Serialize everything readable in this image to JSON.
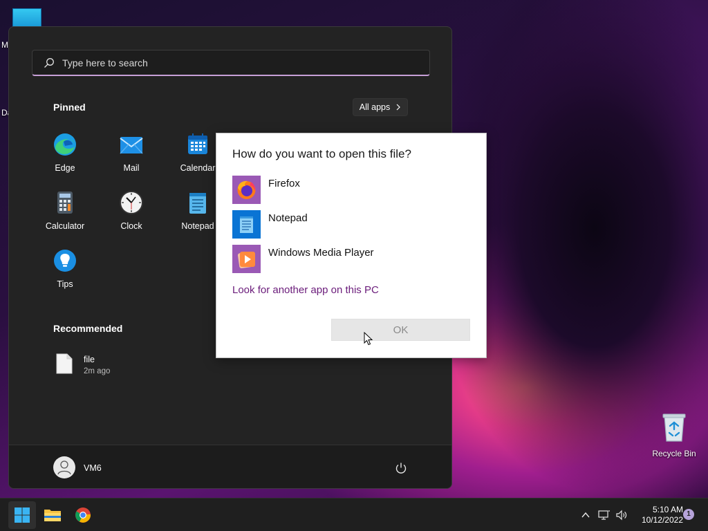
{
  "desktop": {
    "edge_letters": [
      "M",
      "Da"
    ],
    "recycle_bin_label": "Recycle Bin"
  },
  "start_menu": {
    "search": {
      "placeholder": "Type here to search",
      "value": ""
    },
    "pinned_title": "Pinned",
    "all_apps_label": "All apps",
    "pinned_apps": [
      {
        "label": "Edge",
        "icon": "edge-icon"
      },
      {
        "label": "Mail",
        "icon": "mail-icon"
      },
      {
        "label": "Calendar",
        "icon": "calendar-icon"
      },
      {
        "label": "Calculator",
        "icon": "calculator-icon"
      },
      {
        "label": "Clock",
        "icon": "clock-icon"
      },
      {
        "label": "Notepad",
        "icon": "notepad-icon"
      },
      {
        "label": "Tips",
        "icon": "tips-icon"
      }
    ],
    "recommended_title": "Recommended",
    "recommended": [
      {
        "name": "file",
        "time": "2m ago",
        "icon": "document-icon"
      }
    ],
    "user_name": "VM6"
  },
  "dialog": {
    "title": "How do you want to open this file?",
    "apps": [
      {
        "name": "Firefox",
        "icon": "firefox-icon",
        "color": "#9a59b5"
      },
      {
        "name": "Notepad",
        "icon": "notepad-icon",
        "color": "#0a74d4"
      },
      {
        "name": "Windows Media Player",
        "icon": "media-player-icon",
        "color": "#9a59b5"
      }
    ],
    "look_link": "Look for another app on this PC",
    "ok_label": "OK"
  },
  "taskbar": {
    "pinned": [
      "start-icon",
      "file-explorer-icon",
      "chrome-icon"
    ],
    "clock_time": "5:10 AM",
    "clock_date": "10/12/2022",
    "notification_count": "1"
  },
  "colors": {
    "accent": "#c7a0d8",
    "link": "#6a1b7a",
    "menu_bg": "#232323",
    "taskbar_bg": "#1f1f1f"
  }
}
